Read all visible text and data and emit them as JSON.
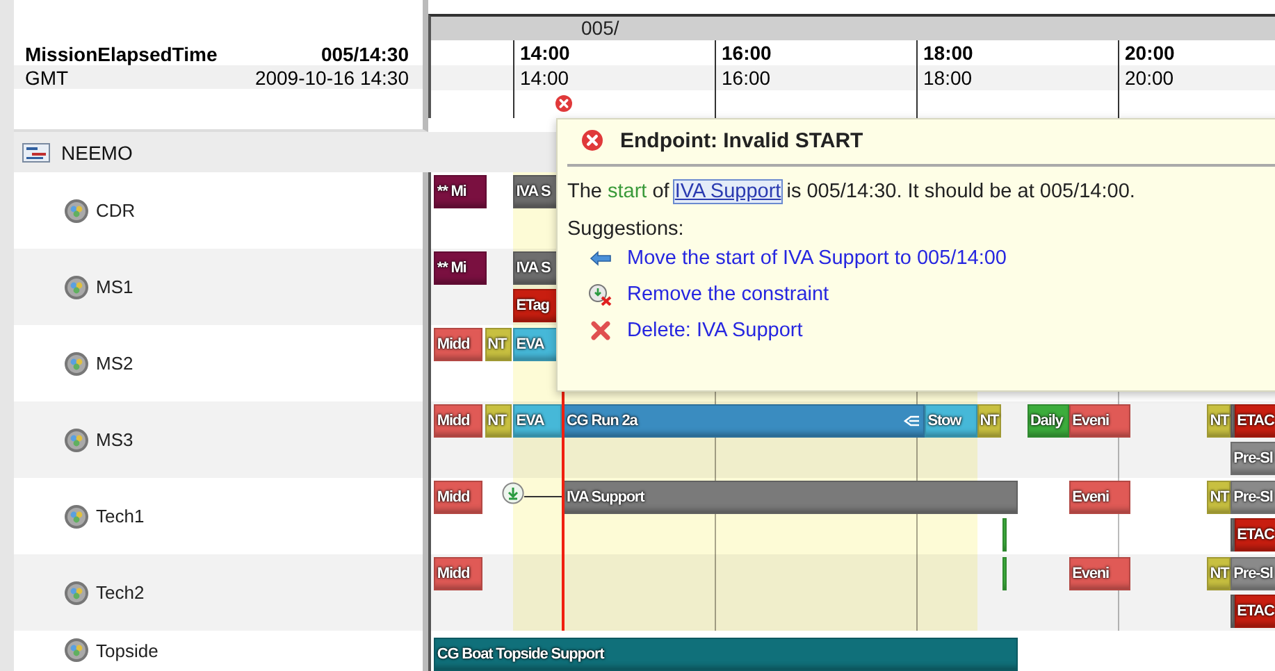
{
  "clock": [
    {
      "name": "MissionElapsedTime",
      "value": "005/14:30"
    },
    {
      "name": "GMT",
      "value": "2009-10-16 14:30"
    }
  ],
  "timeline": {
    "day": "005/",
    "ticks": [
      {
        "met": "14:00",
        "gmt": "14:00"
      },
      {
        "met": "16:00",
        "gmt": "16:00"
      },
      {
        "met": "18:00",
        "gmt": "18:00"
      },
      {
        "met": "20:00",
        "gmt": "20:00"
      }
    ]
  },
  "group": {
    "label": "NEEMO",
    "children": [
      {
        "label": "CDR",
        "bars": [
          {
            "label": "** Mi",
            "color": "#7a1040"
          },
          {
            "label": "IVA S",
            "color": "#6e6e6e"
          }
        ]
      },
      {
        "label": "MS1",
        "bars": [
          {
            "label": "** Mi",
            "color": "#7a1040"
          },
          {
            "label": "IVA S",
            "color": "#6e6e6e"
          },
          {
            "label": "ETag",
            "color": "#c81e10"
          }
        ]
      },
      {
        "label": "MS2",
        "bars": [
          {
            "label": "Midd",
            "color": "#e05a56"
          },
          {
            "label": "NT",
            "color": "#c8c040"
          },
          {
            "label": "EVA",
            "color": "#46b8d8"
          }
        ]
      },
      {
        "label": "MS3",
        "bars": [
          {
            "label": "Midd",
            "color": "#e05a56"
          },
          {
            "label": "NT",
            "color": "#c8c040"
          },
          {
            "label": "EVA",
            "color": "#46b8d8"
          },
          {
            "label": "CG Run 2a",
            "color": "#3a8cc0"
          },
          {
            "label": "Stow",
            "color": "#46b8d8"
          },
          {
            "label": "NT",
            "color": "#c8c040"
          },
          {
            "label": "Daily",
            "color": "#3cac3c"
          },
          {
            "label": "Eveni",
            "color": "#e05a56"
          },
          {
            "label": "NT",
            "color": "#c8c040"
          },
          {
            "color": "#6e6e6e"
          },
          {
            "label": "ETAC",
            "color": "#c81e10"
          },
          {
            "label": "Pre-Sl",
            "color": "#8a8a8a"
          }
        ]
      },
      {
        "label": "Tech1",
        "bars": [
          {
            "label": "Midd",
            "color": "#e05a56"
          },
          {
            "label": "IVA Support",
            "color": "#7a7a7a"
          },
          {
            "label": "Eveni",
            "color": "#e05a56"
          },
          {
            "label": "NT",
            "color": "#c8c040"
          },
          {
            "label": "Pre-Sl",
            "color": "#8a8a8a"
          },
          {
            "color": "#3cac3c"
          },
          {
            "color": "#6e6e6e"
          },
          {
            "label": "ETAC",
            "color": "#c81e10"
          }
        ]
      },
      {
        "label": "Tech2",
        "bars": [
          {
            "label": "Midd",
            "color": "#e05a56"
          },
          {
            "color": "#3cac3c"
          },
          {
            "label": "Eveni",
            "color": "#e05a56"
          },
          {
            "label": "NT",
            "color": "#c8c040"
          },
          {
            "label": "Pre-Sl",
            "color": "#8a8a8a"
          },
          {
            "color": "#6e6e6e"
          },
          {
            "label": "ETAC",
            "color": "#c81e10"
          }
        ]
      },
      {
        "label": "Topside",
        "bars": [
          {
            "label": "CG Boat Topside Support",
            "color": "#10707a"
          }
        ]
      }
    ]
  },
  "popup": {
    "title": "Endpoint: Invalid START",
    "message": {
      "before": "The ",
      "keyword": "start",
      "middle": " of ",
      "link": "IVA Support",
      "after": " is 005/14:30. It should be at 005/14:00."
    },
    "suggestions_label": "Suggestions:",
    "suggestions": [
      {
        "kind": "move",
        "label": "Move the start of IVA Support to 005/14:00"
      },
      {
        "kind": "remove",
        "label": "Remove the constraint"
      },
      {
        "kind": "delete",
        "label": "Delete: IVA Support"
      }
    ]
  }
}
